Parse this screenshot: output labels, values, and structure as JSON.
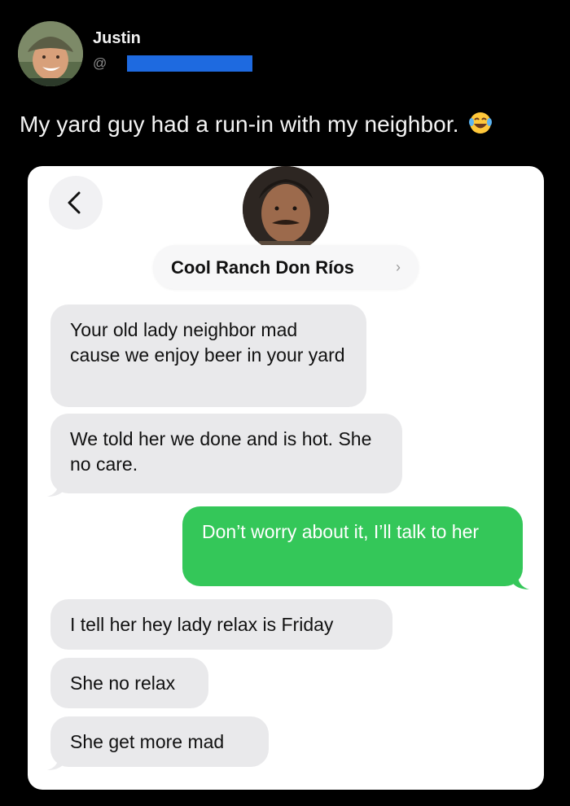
{
  "tweet": {
    "display_name": "Justin",
    "handle_prefix": "@",
    "text": "My yard guy had a run-in with my neighbor.",
    "emoji_icon": "face-with-tears-of-joy-icon"
  },
  "conversation": {
    "back_icon": "chevron-left-icon",
    "contact_name": "Cool Ranch Don Ríos",
    "contact_chevron": "›",
    "messages": [
      {
        "direction": "incoming",
        "text": "Your old lady neighbor mad cause we enjoy beer in your yard"
      },
      {
        "direction": "incoming",
        "text": "We told her we done and is hot. She no care."
      },
      {
        "direction": "outgoing",
        "text": "Don’t worry about it, I’ll talk to her"
      },
      {
        "direction": "incoming",
        "text": "I tell her hey lady relax is Friday"
      },
      {
        "direction": "incoming",
        "text": "She no relax"
      },
      {
        "direction": "incoming",
        "text": "She get more mad"
      }
    ]
  },
  "colors": {
    "page_background": "#000000",
    "incoming_bubble": "#e9e9eb",
    "outgoing_bubble": "#34c759",
    "redaction": "#1e6ae0"
  }
}
